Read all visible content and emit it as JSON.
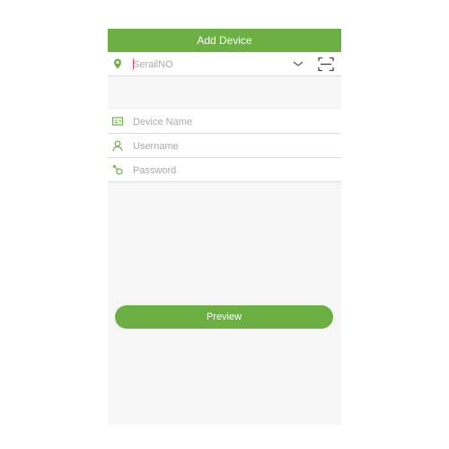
{
  "header": {
    "title": "Add Device"
  },
  "form": {
    "serial": {
      "placeholder": "SerailNO",
      "value": ""
    },
    "device_name": {
      "placeholder": "Device Name",
      "value": ""
    },
    "username": {
      "placeholder": "Username",
      "value": ""
    },
    "password": {
      "placeholder": "Password",
      "value": ""
    }
  },
  "actions": {
    "preview_label": "Preview"
  },
  "icons": {
    "serial": "location-pin-icon",
    "device_name": "device-card-icon",
    "username": "user-icon",
    "password": "key-icon",
    "dropdown": "chevron-down-icon",
    "scan": "qr-scan-icon"
  },
  "colors": {
    "accent": "#6cb043",
    "background": "#f6f6f6",
    "divider": "#dcdcdc"
  }
}
